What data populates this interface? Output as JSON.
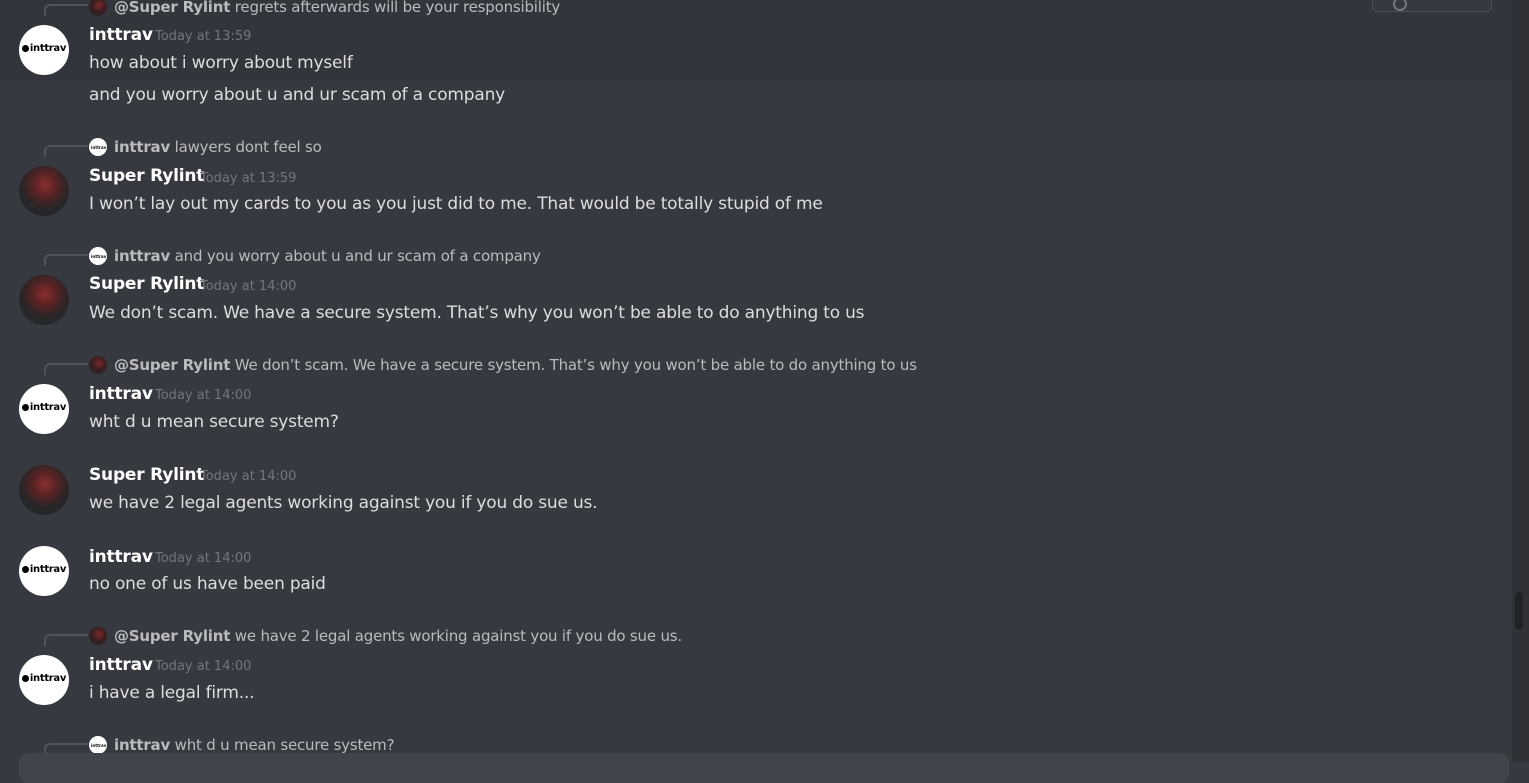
{
  "messages": [
    {
      "reply": {
        "name": "@Super Rylint",
        "text": "regrets afterwards will be your responsibility"
      },
      "author": "inttrav",
      "timestamp": "Today at 13:59",
      "lines": [
        "how about i worry about myself",
        "and you worry about u and ur scam of a company"
      ]
    },
    {
      "reply": {
        "name": "inttrav",
        "text": "lawyers dont feel so"
      },
      "author": "Super Rylint",
      "timestamp": "Today at 13:59",
      "lines": [
        "I won’t lay out my cards to you as you just did to me. That would be totally stupid of me"
      ]
    },
    {
      "reply": {
        "name": "inttrav",
        "text": "and you worry about u and ur scam of a company"
      },
      "author": "Super Rylint",
      "timestamp": "Today at 14:00",
      "lines": [
        "We don’t scam. We have a secure system. That’s why you won’t be able to do anything to us"
      ]
    },
    {
      "reply": {
        "name": "@Super Rylint",
        "text": "We don’t scam. We have a secure system. That’s why you won’t be able to do anything to us"
      },
      "author": "inttrav",
      "timestamp": "Today at 14:00",
      "lines": [
        "wht d u mean secure system?"
      ]
    },
    {
      "author": "Super Rylint",
      "timestamp": "Today at 14:00",
      "lines": [
        "we have 2 legal agents working against you if you do sue us."
      ]
    },
    {
      "author": "inttrav",
      "timestamp": "Today at 14:00",
      "lines": [
        "no one of us have been paid"
      ]
    },
    {
      "reply": {
        "name": "@Super Rylint",
        "text": "we have 2 legal agents working against you if you do sue us."
      },
      "author": "inttrav",
      "timestamp": "Today at 14:00",
      "lines": [
        "i have a legal firm..."
      ]
    },
    {
      "reply": {
        "name": "inttrav",
        "text": "wht d u mean secure system?"
      }
    }
  ],
  "avatars": {
    "inttrav_label": "inttrav",
    "mini_label": "inttrav"
  },
  "colors": {
    "background": "#36393f",
    "username": "#ffffff",
    "message_text": "#dcddde",
    "timestamp": "#72767d",
    "reply_text": "#b9bbbe"
  }
}
